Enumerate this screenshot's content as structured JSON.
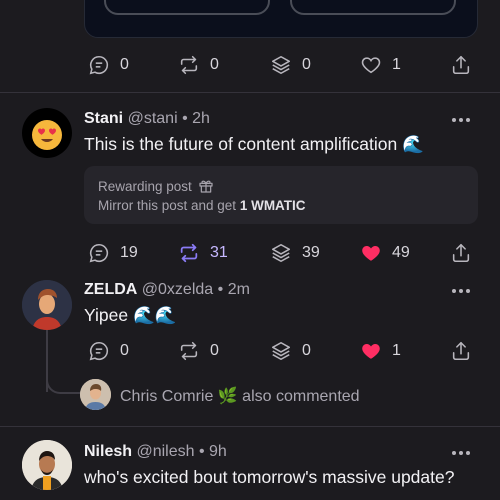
{
  "top_post": {
    "actions": {
      "comments": "0",
      "mirrors": "0",
      "collects": "0",
      "likes": "1"
    }
  },
  "post": {
    "author_name": "Stani",
    "handle": "@stani",
    "time": "2h",
    "text": "This is the future of content amplification 🌊",
    "reward": {
      "title": "Rewarding post",
      "desc_prefix": "Mirror this post and get ",
      "desc_amount": "1 WMATIC"
    },
    "actions": {
      "comments": "19",
      "mirrors": "31",
      "collects": "39",
      "likes": "49"
    }
  },
  "reply": {
    "author_name": "ZELDA",
    "handle": "@0xzelda",
    "time": "2m",
    "text": "Yipee 🌊🌊",
    "actions": {
      "comments": "0",
      "mirrors": "0",
      "collects": "0",
      "likes": "1"
    },
    "also_commented": {
      "name": "Chris Comrie",
      "emoji": "🌿",
      "suffix": "also commented"
    }
  },
  "next_post": {
    "author_name": "Nilesh",
    "handle": "@nilesh",
    "time": "9h",
    "text": "who's excited bout tomorrow's massive update?"
  },
  "separator": "•",
  "colors": {
    "background": "#1c1b1f",
    "like_active": "#ff2e63",
    "mirror_active": "#8b7cf6",
    "text": "#f2f1f4",
    "muted": "#a9a6b0"
  }
}
